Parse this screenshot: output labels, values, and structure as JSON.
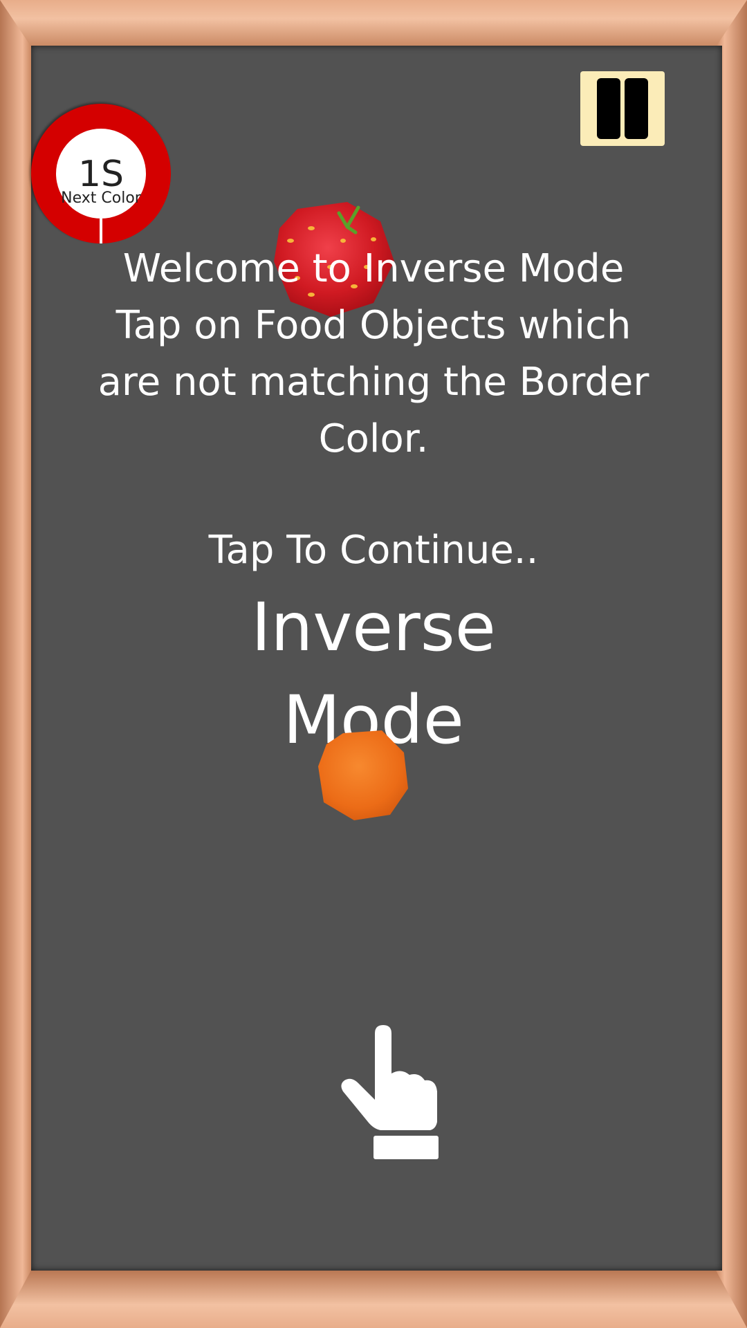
{
  "hud": {
    "pause_icon": "pause-icon",
    "timer": {
      "count": "1S",
      "label": "Next Color",
      "border_color": "#d40000"
    }
  },
  "message": {
    "lines": [
      "Welcome to Inverse Mode",
      "Tap on Food Objects which",
      "are not matching the Border",
      "Color."
    ],
    "continue_label": "Tap To Continue..",
    "mode_title_line1": "Inverse",
    "mode_title_line2": "Mode"
  },
  "objects": {
    "tomato_icon": "tomato-icon",
    "orange_icon": "orange-icon",
    "hand_icon": "tap-hand-icon"
  },
  "colors": {
    "board": "#525252",
    "frame": "#c8865f",
    "pause_bg": "#fbecb8"
  }
}
